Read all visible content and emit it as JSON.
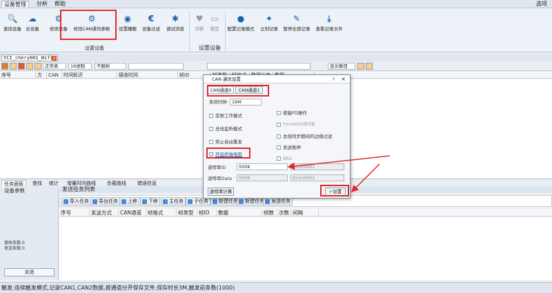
{
  "menubar": {
    "items": [
      "设备管理",
      "分析",
      "帮助"
    ],
    "right": "选项"
  },
  "ribbon": {
    "buttons": [
      {
        "label": "查找设备",
        "icon": "search-icon",
        "glyph": "🔍"
      },
      {
        "label": "云设备",
        "icon": "cloud-icon",
        "glyph": "☁"
      },
      {
        "label": "修改设备",
        "icon": "gear-icon",
        "glyph": "⚙"
      },
      {
        "label": "修改CAN通讯参数",
        "icon": "gears-icon",
        "glyph": "⚙"
      },
      {
        "label": "设置睡眠",
        "icon": "sleep-icon",
        "glyph": "◉"
      },
      {
        "label": "设备过滤",
        "icon": "euro-icon",
        "glyph": "€"
      },
      {
        "label": "调试消息",
        "icon": "bug-icon",
        "glyph": "✱"
      },
      {
        "label": "诊断",
        "icon": "heart-icon",
        "glyph": "♥"
      },
      {
        "label": "锁定",
        "icon": "monitor-icon",
        "glyph": "▭"
      },
      {
        "label": "配置记录模式",
        "icon": "bulb-icon",
        "glyph": "●"
      },
      {
        "label": "立刻记录",
        "icon": "spark-icon",
        "glyph": "✦"
      },
      {
        "label": "暂停全部记录",
        "icon": "pen-icon",
        "glyph": "✎"
      },
      {
        "label": "查看记录文件",
        "icon": "download-icon",
        "glyph": "⤓"
      }
    ],
    "groups": [
      "设置设备",
      "设置设备"
    ]
  },
  "device_tab": "VCI_chery001_Wifi",
  "toolbar2": {
    "mode": "正常表",
    "base": "16进制",
    "parse": "不解析",
    "show_count": "显示数目"
  },
  "grid_headers": [
    "序号",
    "方向",
    "CAN通道",
    "时间标识",
    "接收时间",
    "帧ID",
    "帧类型",
    "帧格式",
    "数据长度",
    "数据"
  ],
  "bottom_tabs": [
    "任务面板",
    "查找",
    "统计",
    "增量时间曲线",
    "负载曲线",
    "错误信息"
  ],
  "left_panel": {
    "title": "设备参数",
    "recv": "接收条数:0",
    "send": "发送条数:0",
    "close": "关闭"
  },
  "send": {
    "title": "发送任务列表",
    "buttons": [
      "导入任务",
      "导出任务",
      "上移",
      "下移",
      "主任务",
      "子任务",
      "新建任务",
      "新建任务",
      "发送任务"
    ],
    "headers": [
      "序号",
      "发送方式",
      "CAN通道",
      "帧格式",
      "帧类型",
      "帧ID",
      "数据",
      "帧数",
      "次数",
      "间隔"
    ]
  },
  "status": "触发:连续触发模式,记录CAN1,CAN2数据,按通道分开保存文件,保存时长3M,触发前条数(1000)",
  "dialog": {
    "title": "CAN 通讯设置",
    "help": "?",
    "close": "×",
    "tabs": [
      "CAN通道0",
      "CAN通道1"
    ],
    "clock_label": "系统时钟",
    "clock_value": "16M",
    "left_options": [
      "受限工作模式",
      "总线监听模式",
      "禁止自动重发",
      "开启终端电阻"
    ],
    "right_options": [
      "使能FD操作",
      "FDCAN比特率切换",
      "总线同步期间的边缘过滤",
      "发送暂停",
      "BRS"
    ],
    "baud_id_label": "波特率ID",
    "baud_id_value": "500K",
    "baud_id_hex": "0x1c0001",
    "baud_data_label": "波特率Data",
    "baud_data_value": "500K",
    "baud_data_hex": "0x1c0001",
    "calc_button": "波特率计算",
    "set_button": "设置"
  },
  "colors": {
    "highlight": "#e0282a",
    "accent": "#1a5fa8"
  }
}
